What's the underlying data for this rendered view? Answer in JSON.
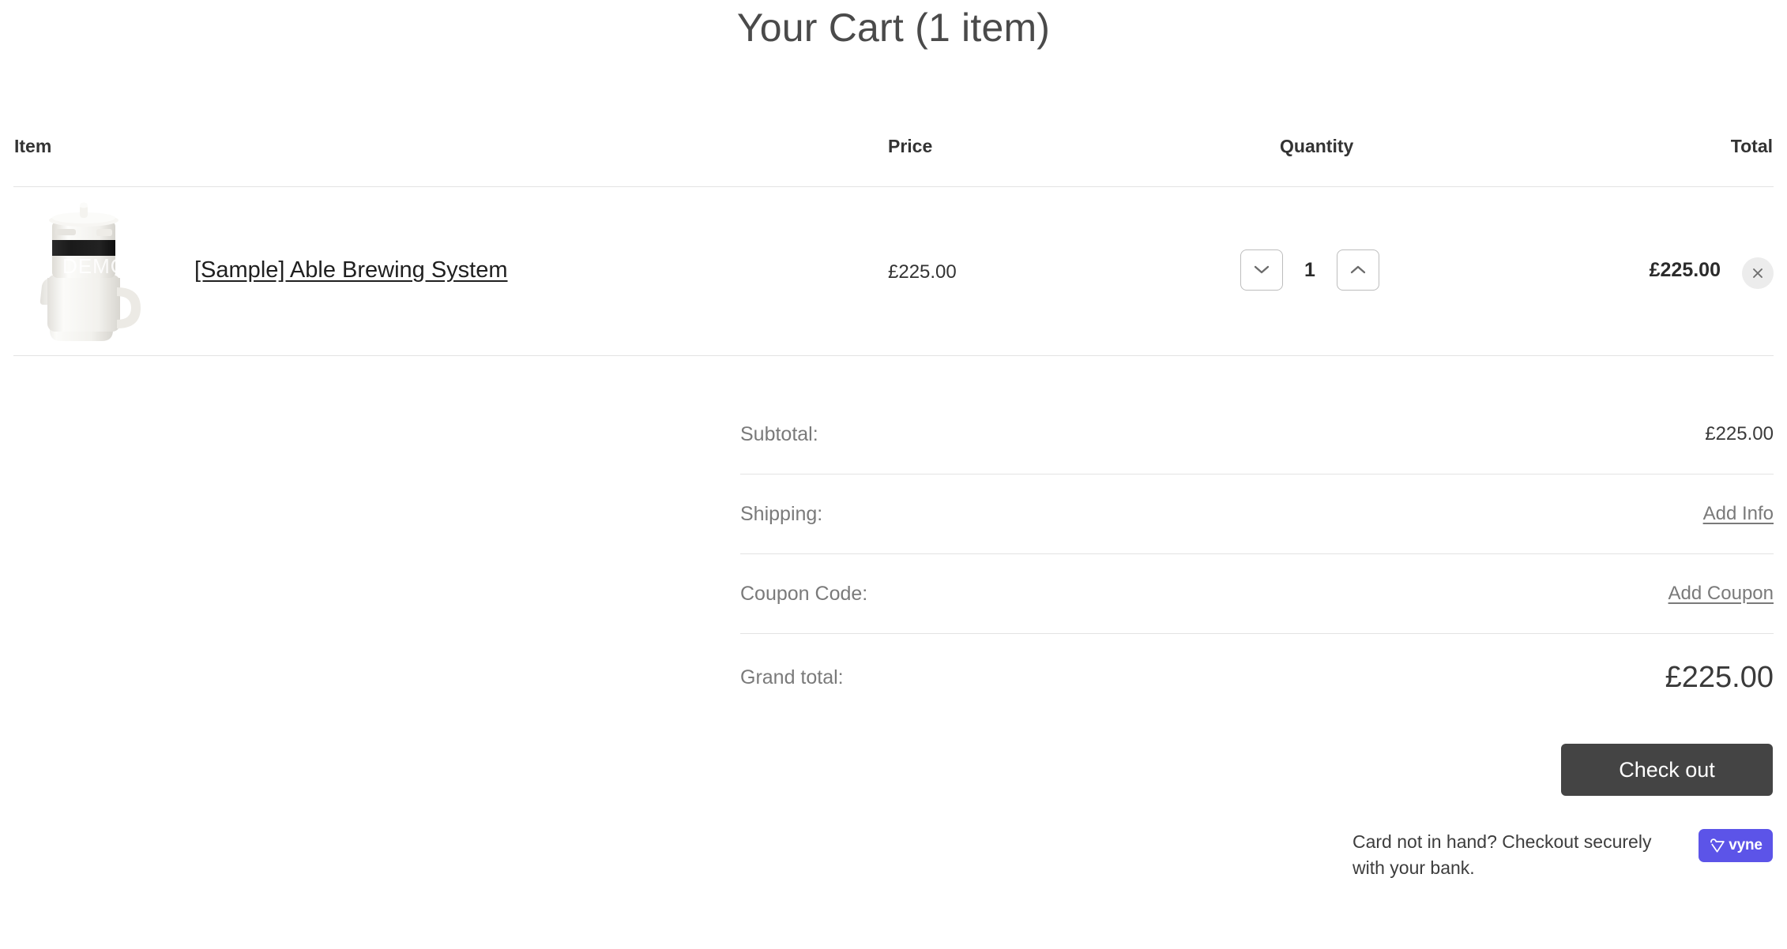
{
  "page": {
    "title": "Your Cart (1 item)"
  },
  "table": {
    "headers": {
      "item": "Item",
      "price": "Price",
      "quantity": "Quantity",
      "total": "Total"
    },
    "rows": [
      {
        "product_name": "[Sample] Able Brewing System",
        "image_watermark": "DEMO",
        "price": "£225.00",
        "quantity": "1",
        "total": "£225.00",
        "decrease_icon": "chevron-down-icon",
        "increase_icon": "chevron-up-icon",
        "remove_icon": "close-icon"
      }
    ]
  },
  "summary": {
    "subtotal_label": "Subtotal:",
    "subtotal_value": "£225.00",
    "shipping_label": "Shipping:",
    "shipping_link": "Add Info",
    "coupon_label": "Coupon Code:",
    "coupon_link": "Add Coupon",
    "grand_total_label": "Grand total:",
    "grand_total_value": "£225.00"
  },
  "actions": {
    "checkout_label": "Check out",
    "vyne_note": "Card not in hand? Checkout securely with your bank.",
    "vyne_label": "vyne",
    "vyne_icon": "vyne-logo-icon"
  },
  "colors": {
    "checkout_bg": "#444444",
    "vyne_bg": "#5c54e8",
    "divider": "#e3e3e3",
    "remove_bg": "#ececec"
  }
}
